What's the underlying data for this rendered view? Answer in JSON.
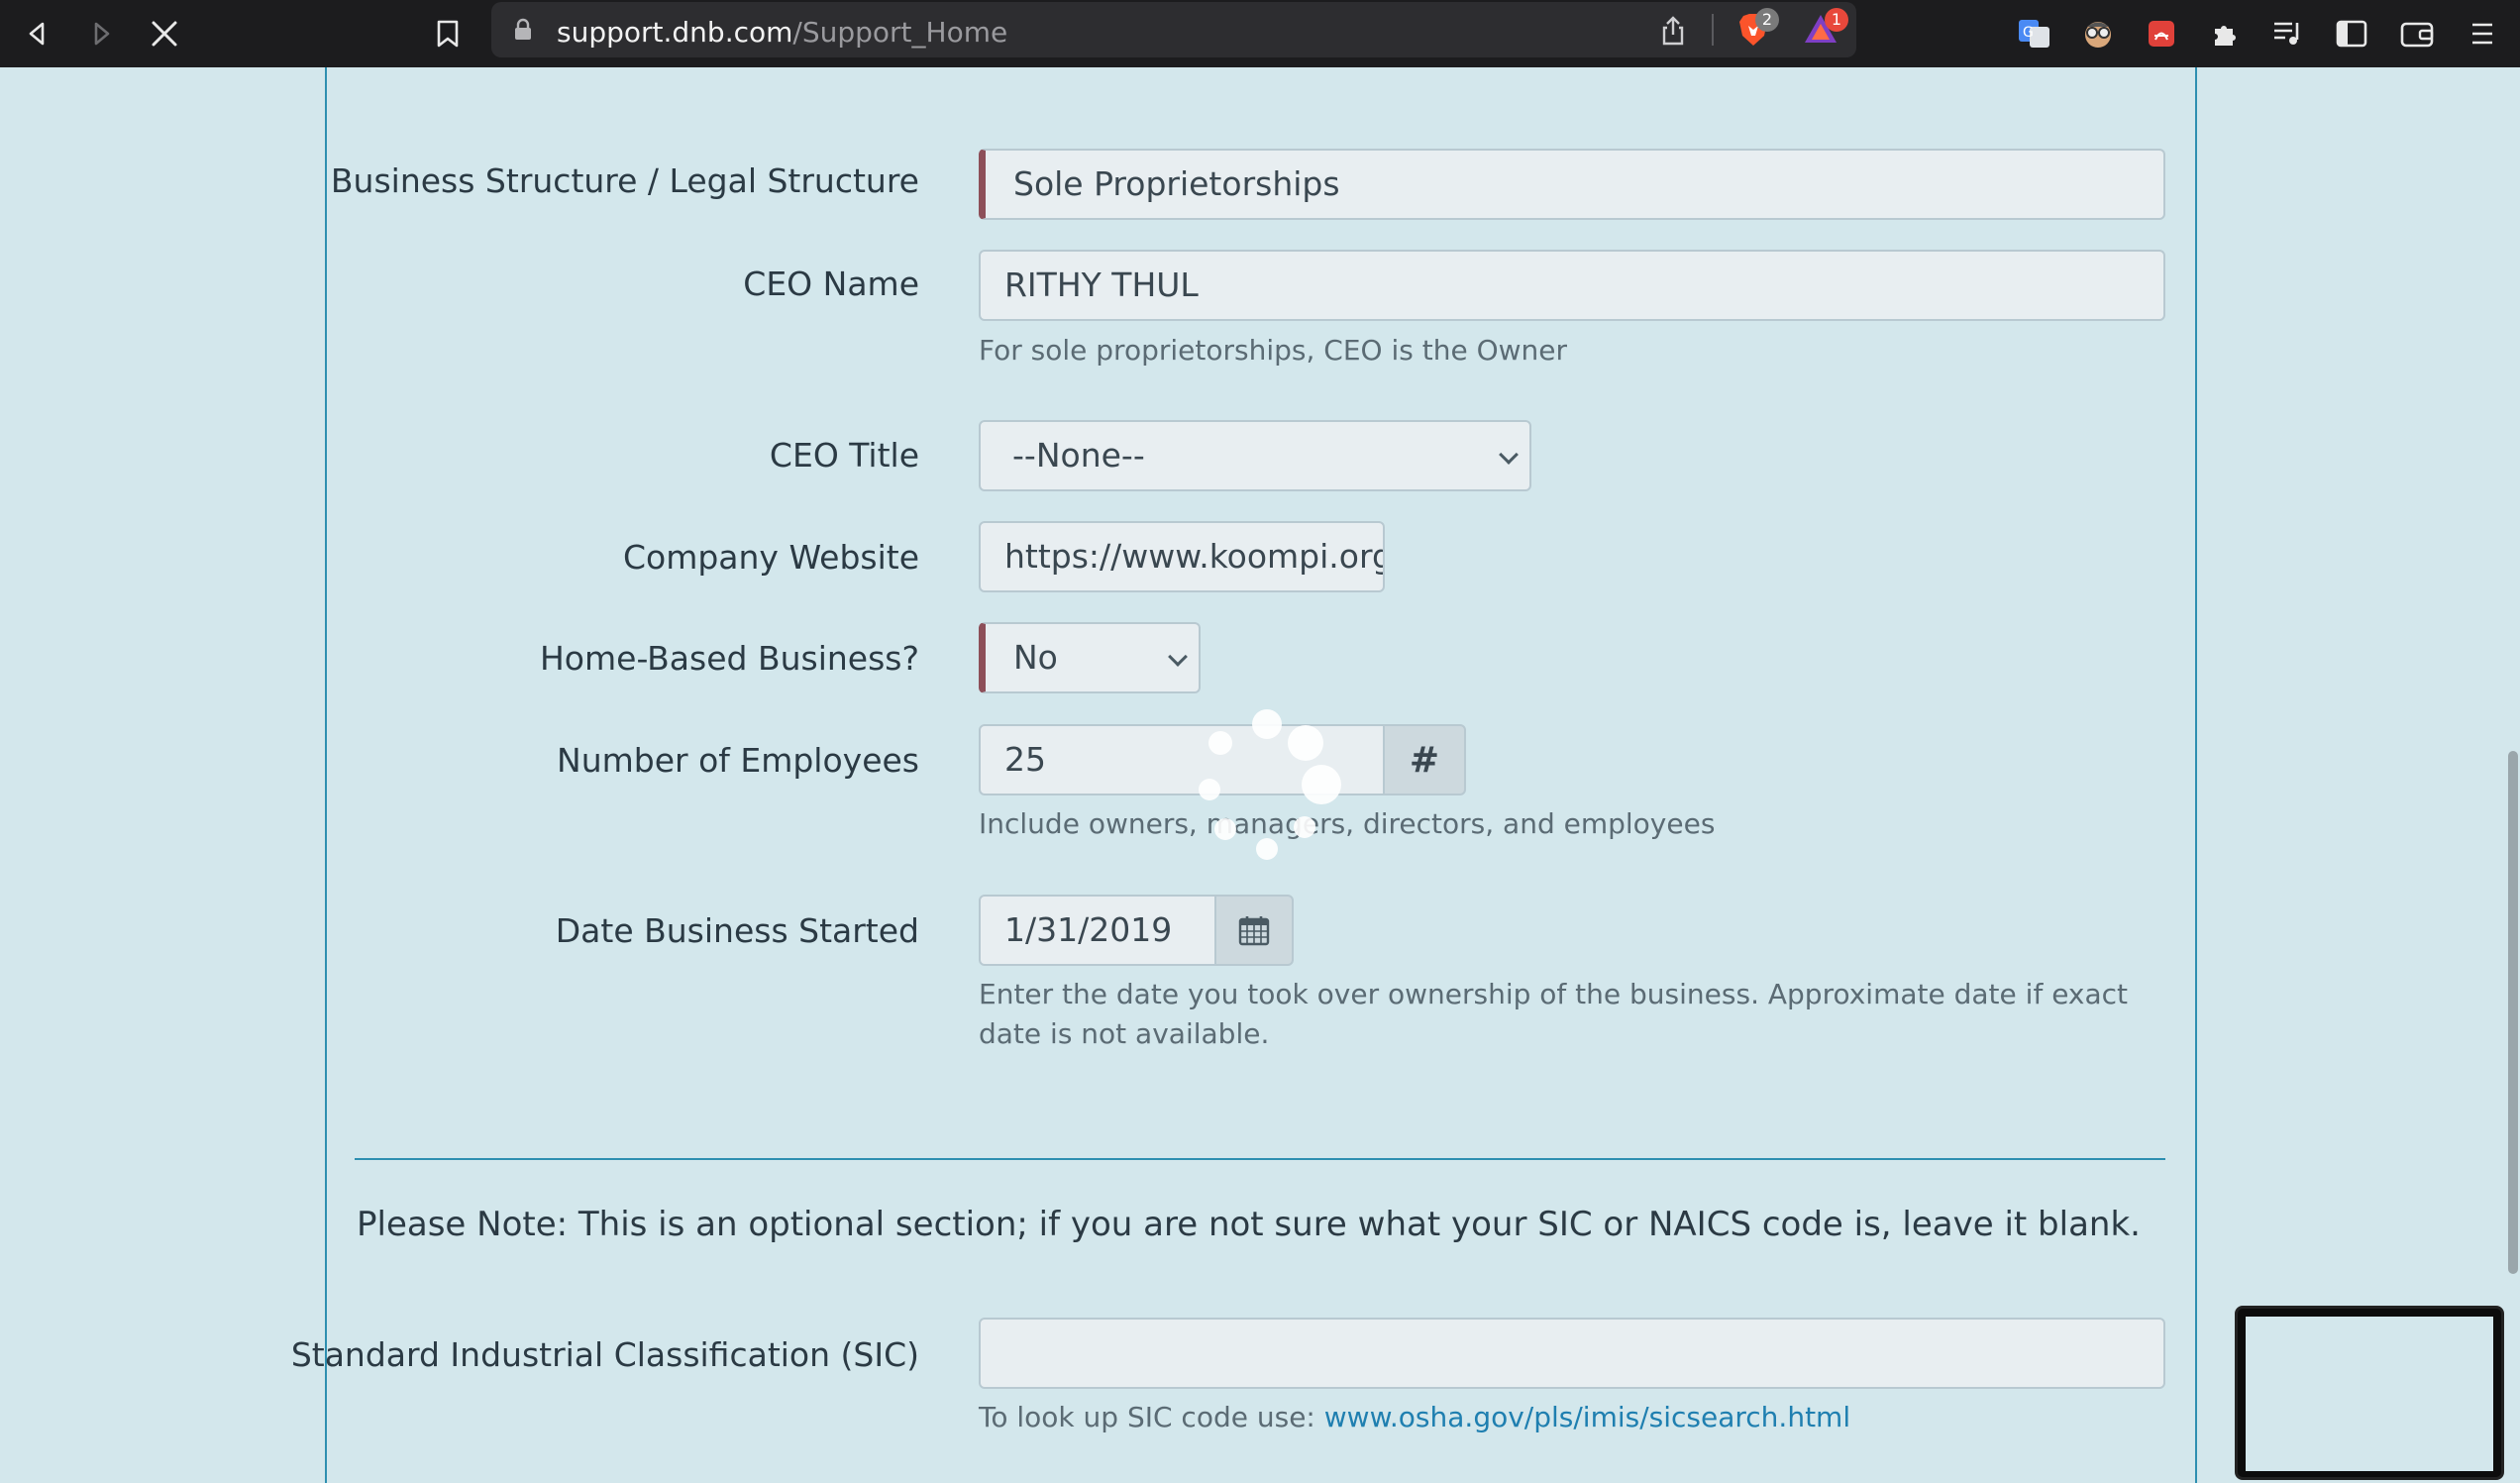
{
  "browser": {
    "url_host": "support.dnb.com",
    "url_path": "/Support_Home",
    "brave_badge": "2",
    "alert_badge": "1"
  },
  "form": {
    "business_structure": {
      "label": "Business Structure / Legal Structure",
      "value": "Sole Proprietorships"
    },
    "ceo_name": {
      "label": "CEO Name",
      "value": "RITHY THUL",
      "help": "For sole proprietorships, CEO is the Owner"
    },
    "ceo_title": {
      "label": "CEO Title",
      "value": "--None--"
    },
    "company_website": {
      "label": "Company Website",
      "value": "https://www.koompi.org"
    },
    "home_based": {
      "label": "Home-Based Business?",
      "value": "No"
    },
    "employees": {
      "label": "Number of Employees",
      "value": "25",
      "addon": "#",
      "help": "Include owners, managers, directors, and employees"
    },
    "date_started": {
      "label": "Date Business Started",
      "value": "1/31/2019",
      "help": "Enter the date you took over ownership of the business. Approximate date if exact date is not available."
    },
    "note": "Please Note: This is an optional section; if you are not sure what your SIC or NAICS code is, leave it blank.",
    "sic": {
      "label": "Standard Industrial Classification (SIC)",
      "value": "",
      "help_prefix": "To look up SIC code use: ",
      "help_link": "www.osha.gov/pls/imis/sicsearch.html"
    }
  }
}
